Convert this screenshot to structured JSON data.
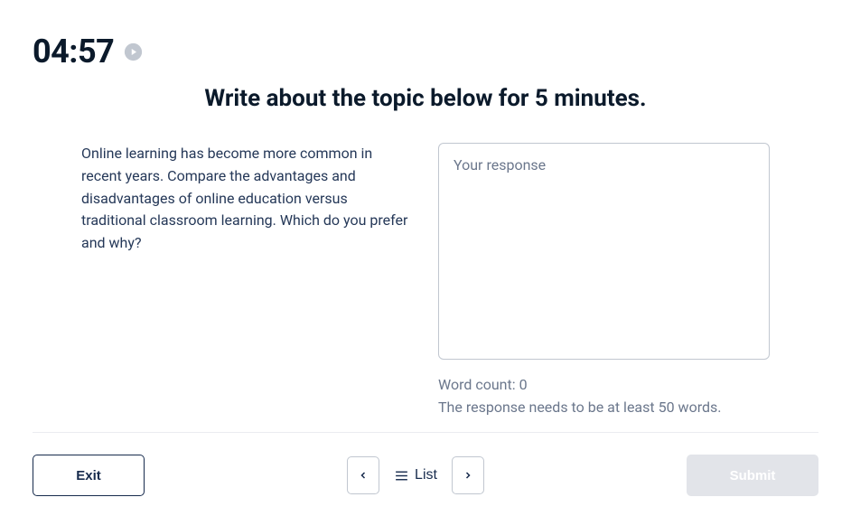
{
  "timer": "04:57",
  "instruction": "Write about the topic below for 5 minutes.",
  "prompt_text": "Online learning has become more common in recent years. Compare the advantages and disadvantages of online education versus traditional classroom learning. Which do you prefer and why?",
  "response": {
    "placeholder": "Your response",
    "value": ""
  },
  "word_count_label": "Word count: 0",
  "min_words_label": "The response needs to be at least 50 words.",
  "footer": {
    "exit_label": "Exit",
    "list_label": "List",
    "submit_label": "Submit"
  }
}
